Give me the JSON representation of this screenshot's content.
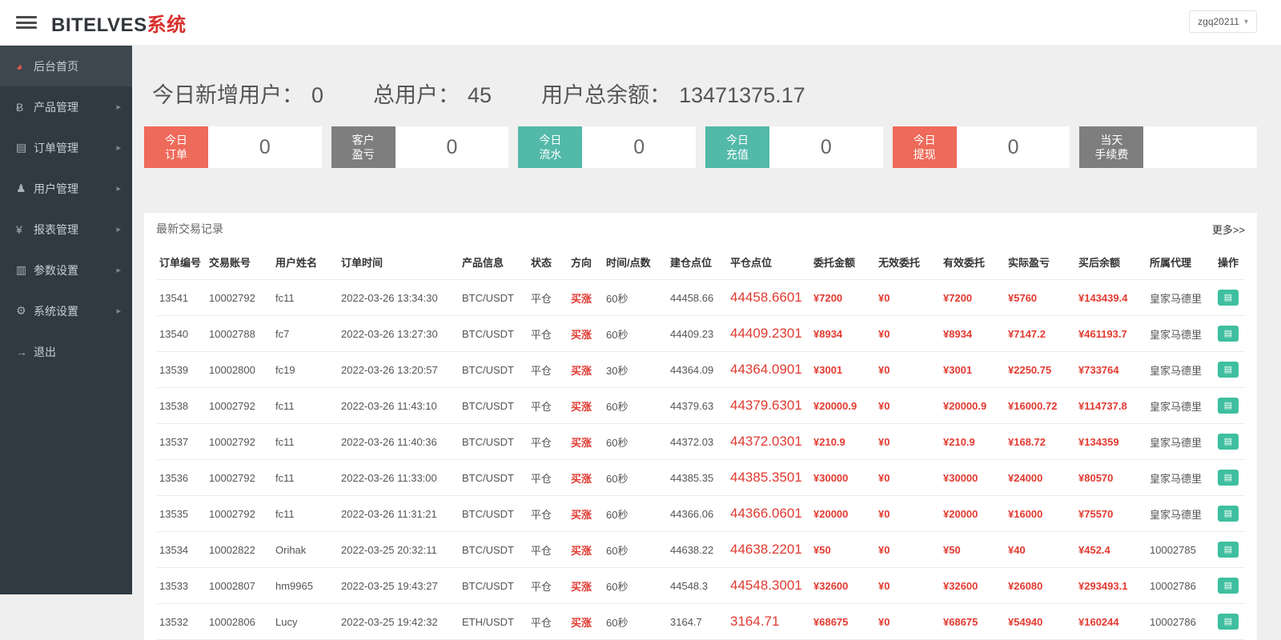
{
  "topbar": {
    "brand_name": "BITELVES",
    "brand_suffix": "系统",
    "user": "zgq20211"
  },
  "sidebar": {
    "items": [
      {
        "label": "后台首页",
        "icon": "dashboard-icon",
        "active": true,
        "arrow": false
      },
      {
        "label": "产品管理",
        "icon": "product-icon",
        "active": false,
        "arrow": true
      },
      {
        "label": "订单管理",
        "icon": "order-icon",
        "active": false,
        "arrow": true
      },
      {
        "label": "用户管理",
        "icon": "user-icon",
        "active": false,
        "arrow": true
      },
      {
        "label": "报表管理",
        "icon": "report-icon",
        "active": false,
        "arrow": true
      },
      {
        "label": "参数设置",
        "icon": "params-icon",
        "active": false,
        "arrow": true
      },
      {
        "label": "系统设置",
        "icon": "settings-icon",
        "active": false,
        "arrow": true
      },
      {
        "label": "退出",
        "icon": "logout-icon",
        "active": false,
        "arrow": false
      }
    ]
  },
  "overview": {
    "stats": [
      {
        "label": "今日新增用户：",
        "value": "0"
      },
      {
        "label": "总用户：",
        "value": "45"
      },
      {
        "label": "用户总余额：",
        "value": "13471375.17"
      }
    ],
    "cards": [
      {
        "label_lines": [
          "今日",
          "订单"
        ],
        "value": "0",
        "color": "red"
      },
      {
        "label_lines": [
          "客户",
          "盈亏"
        ],
        "value": "0",
        "color": "gray"
      },
      {
        "label_lines": [
          "今日",
          "流水"
        ],
        "value": "0",
        "color": "teal"
      },
      {
        "label_lines": [
          "今日",
          "充值"
        ],
        "value": "0",
        "color": "teal"
      },
      {
        "label_lines": [
          "今日",
          "提现"
        ],
        "value": "0",
        "color": "red"
      },
      {
        "label_lines": [
          "当天",
          "手续费"
        ],
        "value": "",
        "color": "gray"
      }
    ]
  },
  "panel": {
    "title": "最新交易记录",
    "more_label": "更多>>"
  },
  "table": {
    "headers": [
      "订单编号",
      "交易账号",
      "用户姓名",
      "订单时间",
      "产品信息",
      "状态",
      "方向",
      "时间/点数",
      "建仓点位",
      "平仓点位",
      "委托金额",
      "无效委托",
      "有效委托",
      "实际盈亏",
      "买后余额",
      "所属代理",
      "操作"
    ],
    "rows": [
      {
        "order_id": "13541",
        "account": "10002792",
        "name": "fc11",
        "time": "2022-03-26 13:34:30",
        "product": "BTC/USDT",
        "status": "平仓",
        "direction": "买涨",
        "duration": "60秒",
        "open": "44458.66",
        "close": "44458.6601",
        "amount": "¥7200",
        "invalid": "¥0",
        "valid": "¥7200",
        "profit": "¥5760",
        "balance": "¥143439.4",
        "agent": "皇家马德里"
      },
      {
        "order_id": "13540",
        "account": "10002788",
        "name": "fc7",
        "time": "2022-03-26 13:27:30",
        "product": "BTC/USDT",
        "status": "平仓",
        "direction": "买涨",
        "duration": "60秒",
        "open": "44409.23",
        "close": "44409.2301",
        "amount": "¥8934",
        "invalid": "¥0",
        "valid": "¥8934",
        "profit": "¥7147.2",
        "balance": "¥461193.7",
        "agent": "皇家马德里"
      },
      {
        "order_id": "13539",
        "account": "10002800",
        "name": "fc19",
        "time": "2022-03-26 13:20:57",
        "product": "BTC/USDT",
        "status": "平仓",
        "direction": "买涨",
        "duration": "30秒",
        "open": "44364.09",
        "close": "44364.0901",
        "amount": "¥3001",
        "invalid": "¥0",
        "valid": "¥3001",
        "profit": "¥2250.75",
        "balance": "¥733764",
        "agent": "皇家马德里"
      },
      {
        "order_id": "13538",
        "account": "10002792",
        "name": "fc11",
        "time": "2022-03-26 11:43:10",
        "product": "BTC/USDT",
        "status": "平仓",
        "direction": "买涨",
        "duration": "60秒",
        "open": "44379.63",
        "close": "44379.6301",
        "amount": "¥20000.9",
        "invalid": "¥0",
        "valid": "¥20000.9",
        "profit": "¥16000.72",
        "balance": "¥114737.8",
        "agent": "皇家马德里"
      },
      {
        "order_id": "13537",
        "account": "10002792",
        "name": "fc11",
        "time": "2022-03-26 11:40:36",
        "product": "BTC/USDT",
        "status": "平仓",
        "direction": "买涨",
        "duration": "60秒",
        "open": "44372.03",
        "close": "44372.0301",
        "amount": "¥210.9",
        "invalid": "¥0",
        "valid": "¥210.9",
        "profit": "¥168.72",
        "balance": "¥134359",
        "agent": "皇家马德里"
      },
      {
        "order_id": "13536",
        "account": "10002792",
        "name": "fc11",
        "time": "2022-03-26 11:33:00",
        "product": "BTC/USDT",
        "status": "平仓",
        "direction": "买涨",
        "duration": "60秒",
        "open": "44385.35",
        "close": "44385.3501",
        "amount": "¥30000",
        "invalid": "¥0",
        "valid": "¥30000",
        "profit": "¥24000",
        "balance": "¥80570",
        "agent": "皇家马德里"
      },
      {
        "order_id": "13535",
        "account": "10002792",
        "name": "fc11",
        "time": "2022-03-26 11:31:21",
        "product": "BTC/USDT",
        "status": "平仓",
        "direction": "买涨",
        "duration": "60秒",
        "open": "44366.06",
        "close": "44366.0601",
        "amount": "¥20000",
        "invalid": "¥0",
        "valid": "¥20000",
        "profit": "¥16000",
        "balance": "¥75570",
        "agent": "皇家马德里"
      },
      {
        "order_id": "13534",
        "account": "10002822",
        "name": "Orihak",
        "time": "2022-03-25 20:32:11",
        "product": "BTC/USDT",
        "status": "平仓",
        "direction": "买涨",
        "duration": "60秒",
        "open": "44638.22",
        "close": "44638.2201",
        "amount": "¥50",
        "invalid": "¥0",
        "valid": "¥50",
        "profit": "¥40",
        "balance": "¥452.4",
        "agent": "10002785"
      },
      {
        "order_id": "13533",
        "account": "10002807",
        "name": "hm9965",
        "time": "2022-03-25 19:43:27",
        "product": "BTC/USDT",
        "status": "平仓",
        "direction": "买涨",
        "duration": "60秒",
        "open": "44548.3",
        "close": "44548.3001",
        "amount": "¥32600",
        "invalid": "¥0",
        "valid": "¥32600",
        "profit": "¥26080",
        "balance": "¥293493.1",
        "agent": "10002786"
      },
      {
        "order_id": "13532",
        "account": "10002806",
        "name": "Lucy",
        "time": "2022-03-25 19:42:32",
        "product": "ETH/USDT",
        "status": "平仓",
        "direction": "买涨",
        "duration": "60秒",
        "open": "3164.7",
        "close": "3164.71",
        "amount": "¥68675",
        "invalid": "¥0",
        "valid": "¥68675",
        "profit": "¥54940",
        "balance": "¥160244",
        "agent": "10002786"
      }
    ]
  },
  "colors": {
    "accent_red": "#ee6a5a",
    "accent_teal": "#53b9a9",
    "accent_gray": "#7e7e7e",
    "brand_red": "#d9302c",
    "table_red": "#e13a30",
    "action_green": "#3fbf9f",
    "sidebar_bg": "#2f3a42"
  }
}
